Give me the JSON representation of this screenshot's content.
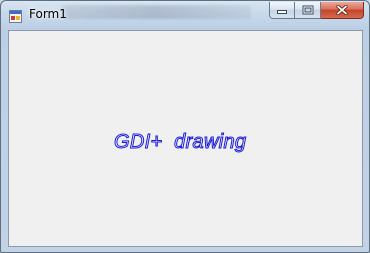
{
  "window": {
    "title": "Form1",
    "icons": {
      "app": "form-app-icon",
      "minimize": "minimize-icon",
      "maximize": "maximize-icon",
      "close": "close-icon"
    }
  },
  "canvas": {
    "text": "GDI+  drawing",
    "text_stroke_color": "#1a1ad6",
    "background_color": "#f0f0f0"
  },
  "colors": {
    "close_button": "#c2442a",
    "frame": "#c8d9ea"
  }
}
